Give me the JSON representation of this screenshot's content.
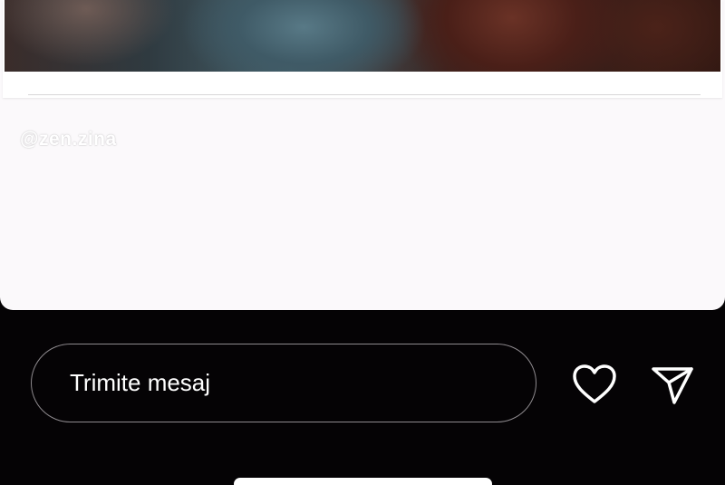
{
  "story": {
    "username": "@zen.zina"
  },
  "reply_bar": {
    "message_placeholder": "Trimite mesaj",
    "like_icon": "heart-icon",
    "share_icon": "send-icon"
  },
  "colors": {
    "background": "#050305",
    "card": "#fbf9fb",
    "input_border": "#8e8a8e",
    "text": "#ffffff"
  }
}
